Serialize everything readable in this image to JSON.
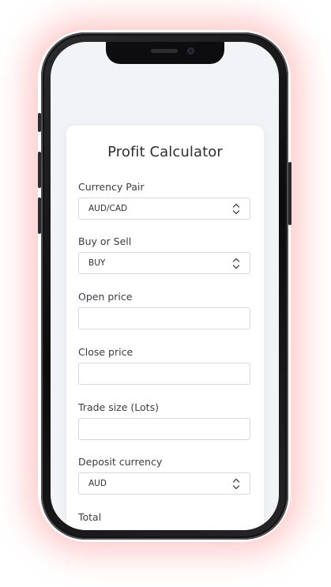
{
  "calculator": {
    "title": "Profit Calculator",
    "currency_pair": {
      "label": "Currency Pair",
      "value": "AUD/CAD"
    },
    "buy_or_sell": {
      "label": "Buy or Sell",
      "value": "BUY"
    },
    "open_price": {
      "label": "Open price",
      "value": ""
    },
    "close_price": {
      "label": "Close price",
      "value": ""
    },
    "trade_size": {
      "label": "Trade size (Lots)",
      "value": ""
    },
    "deposit_currency": {
      "label": "Deposit currency",
      "value": "AUD"
    },
    "total": {
      "label": "Total"
    }
  },
  "icons": {
    "select_arrows": "chevron-updown-icon"
  },
  "colors": {
    "glow": "#ff6e6e",
    "screen_bg": "#f2f3f7",
    "card_bg": "#ffffff",
    "border": "#d6d8de",
    "text": "#2d2f36"
  }
}
